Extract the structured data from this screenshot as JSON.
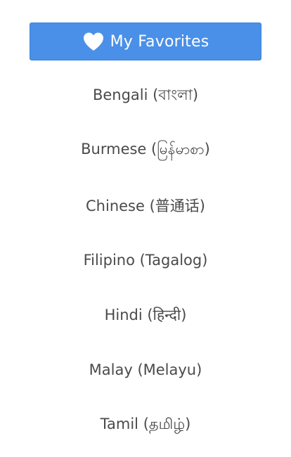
{
  "favorites_button": {
    "label": "My Favorites",
    "icon": "heart-icon",
    "bg_color": "#4a90e8",
    "text_color": "#ffffff"
  },
  "languages": [
    {
      "label": "Bengali (বাংলা)"
    },
    {
      "label": "Burmese (မြန်မာစာ)"
    },
    {
      "label": "Chinese (普通话)"
    },
    {
      "label": "Filipino (Tagalog)"
    },
    {
      "label": "Hindi (हिन्दी)"
    },
    {
      "label": "Malay (Melayu)"
    },
    {
      "label": "Tamil (தமிழ்)"
    }
  ],
  "colors": {
    "background": "#ffffff",
    "list_text": "#4a4a4a"
  }
}
